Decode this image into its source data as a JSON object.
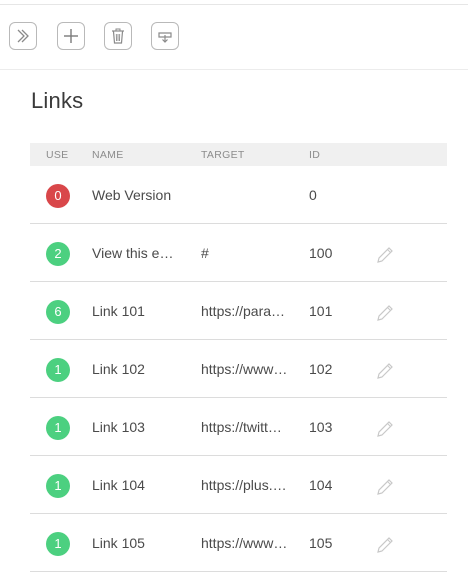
{
  "toolbar": {
    "buttons": [
      {
        "icon": "chevron-right-double-icon"
      },
      {
        "icon": "plus-icon"
      },
      {
        "icon": "trash-icon"
      },
      {
        "icon": "download-tray-icon"
      }
    ]
  },
  "page": {
    "title": "Links"
  },
  "table": {
    "headers": {
      "use": "USE",
      "name": "NAME",
      "target": "TARGET",
      "id": "ID"
    },
    "rows": [
      {
        "use": "0",
        "use_color": "#d9474a",
        "name": "Web Version",
        "target": "",
        "id": "0",
        "editable": false
      },
      {
        "use": "2",
        "use_color": "#4cd080",
        "name": "View this e…",
        "target": "#",
        "id": "100",
        "editable": true
      },
      {
        "use": "6",
        "use_color": "#4cd080",
        "name": "Link 101",
        "target": "https://para…",
        "id": "101",
        "editable": true
      },
      {
        "use": "1",
        "use_color": "#4cd080",
        "name": "Link 102",
        "target": "https://www…",
        "id": "102",
        "editable": true
      },
      {
        "use": "1",
        "use_color": "#4cd080",
        "name": "Link 103",
        "target": "https://twitt…",
        "id": "103",
        "editable": true
      },
      {
        "use": "1",
        "use_color": "#4cd080",
        "name": "Link 104",
        "target": "https://plus.…",
        "id": "104",
        "editable": true
      },
      {
        "use": "1",
        "use_color": "#4cd080",
        "name": "Link 105",
        "target": "https://www…",
        "id": "105",
        "editable": true
      }
    ]
  },
  "colors": {
    "accent_green": "#4cd080",
    "accent_red": "#d9474a",
    "header_bg": "#f0f0f0"
  }
}
